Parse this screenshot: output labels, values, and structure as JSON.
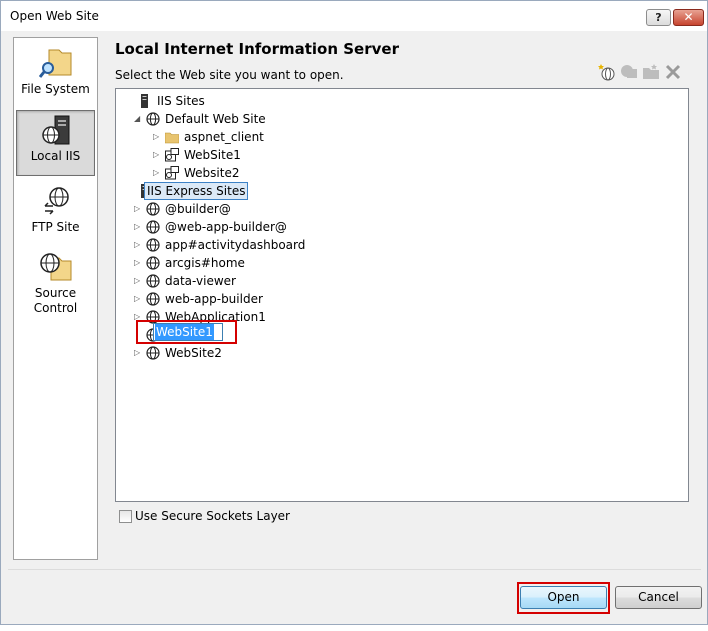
{
  "window": {
    "title": "Open Web Site",
    "help_glyph": "?",
    "close_glyph": "✕"
  },
  "sidebar": {
    "items": [
      {
        "label": "File System",
        "icon": "file-system-icon",
        "active": false
      },
      {
        "label": "Local IIS",
        "icon": "local-iis-icon",
        "active": true
      },
      {
        "label": "FTP Site",
        "icon": "ftp-site-icon",
        "active": false
      },
      {
        "label": "Source Control",
        "icon": "source-control-icon",
        "active": false
      }
    ]
  },
  "main": {
    "heading": "Local Internet Information Server",
    "subheading": "Select the Web site you want to open.",
    "toolbar_icons": [
      "create-web-application-icon",
      "create-virtual-directory-icon",
      "new-folder-icon",
      "delete-icon"
    ]
  },
  "tree": {
    "nodes": [
      {
        "label": "IIS Sites",
        "icon": "server-icon",
        "expander": ""
      },
      {
        "label": "Default Web Site",
        "icon": "globe-icon",
        "expander": "◢"
      },
      {
        "label": "aspnet_client",
        "icon": "folder-icon",
        "expander": "▷"
      },
      {
        "label": "WebSite1",
        "icon": "web-app-icon",
        "expander": "▷"
      },
      {
        "label": "Website2",
        "icon": "web-app-icon",
        "expander": "▷"
      },
      {
        "label": "IIS Express Sites",
        "icon": "server-icon",
        "expander": ""
      },
      {
        "label": "@builder@",
        "icon": "globe-icon",
        "expander": "▷"
      },
      {
        "label": "@web-app-builder@",
        "icon": "globe-icon",
        "expander": "▷"
      },
      {
        "label": "app#activitydashboard",
        "icon": "globe-icon",
        "expander": "▷"
      },
      {
        "label": "arcgis#home",
        "icon": "globe-icon",
        "expander": "▷"
      },
      {
        "label": "data-viewer",
        "icon": "globe-icon",
        "expander": "▷"
      },
      {
        "label": "web-app-builder",
        "icon": "globe-icon",
        "expander": "▷"
      },
      {
        "label": "WebApplication1",
        "icon": "globe-icon",
        "expander": "▷"
      },
      {
        "label": "WebSite1",
        "icon": "globe-icon",
        "expander": ""
      },
      {
        "label": "WebSite2",
        "icon": "globe-icon",
        "expander": "▷"
      }
    ],
    "rename_value": "WebSite1"
  },
  "options": {
    "ssl_label": "Use Secure Sockets Layer",
    "ssl_checked": false
  },
  "buttons": {
    "open": "Open",
    "cancel": "Cancel"
  },
  "colors": {
    "highlight_outline": "#d40000",
    "selection": "#3399ff"
  }
}
